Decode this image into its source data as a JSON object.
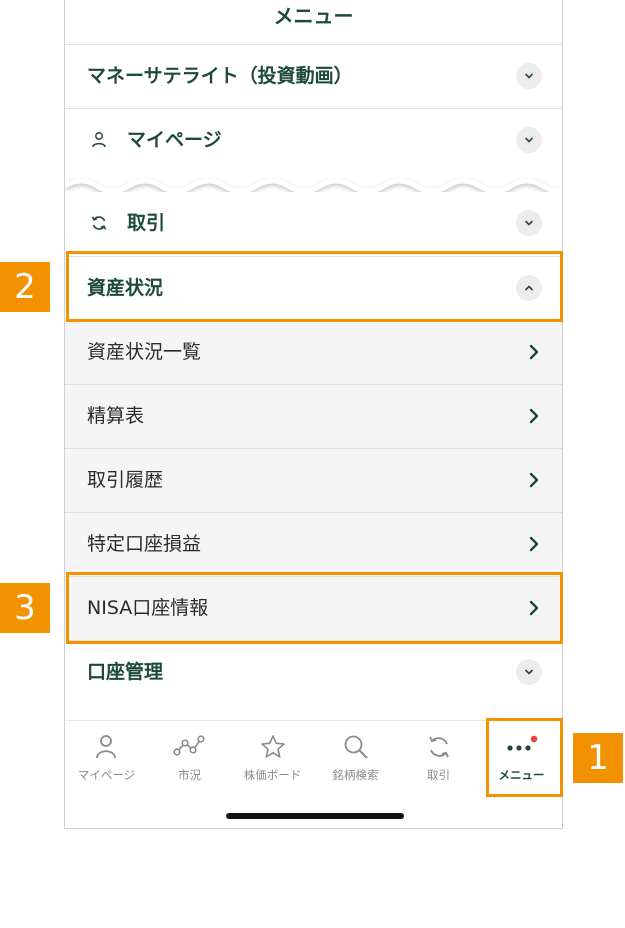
{
  "header": {
    "title": "メニュー"
  },
  "menu": {
    "money_satellite": "マネーサテライト（投資動画）",
    "mypage": "マイページ",
    "trade": "取引",
    "assets": "資産状況",
    "account_mgmt": "口座管理"
  },
  "assets_sub": [
    {
      "label": "資産状況一覧"
    },
    {
      "label": "精算表"
    },
    {
      "label": "取引履歴"
    },
    {
      "label": "特定口座損益"
    },
    {
      "label": "NISA口座情報"
    }
  ],
  "tabbar": [
    {
      "label": "マイページ",
      "icon": "person-icon"
    },
    {
      "label": "市況",
      "icon": "market-chart-icon"
    },
    {
      "label": "株価ボード",
      "icon": "star-icon"
    },
    {
      "label": "銘柄検索",
      "icon": "search-icon"
    },
    {
      "label": "取引",
      "icon": "cycle-icon"
    },
    {
      "label": "メニュー",
      "icon": "more-dots-icon",
      "active": true,
      "notification": true
    }
  ],
  "callouts": [
    "1",
    "2",
    "3"
  ],
  "colors": {
    "brand_green": "#1e4a3a",
    "accent_orange": "#f39200",
    "notify_red": "#e0483a"
  }
}
